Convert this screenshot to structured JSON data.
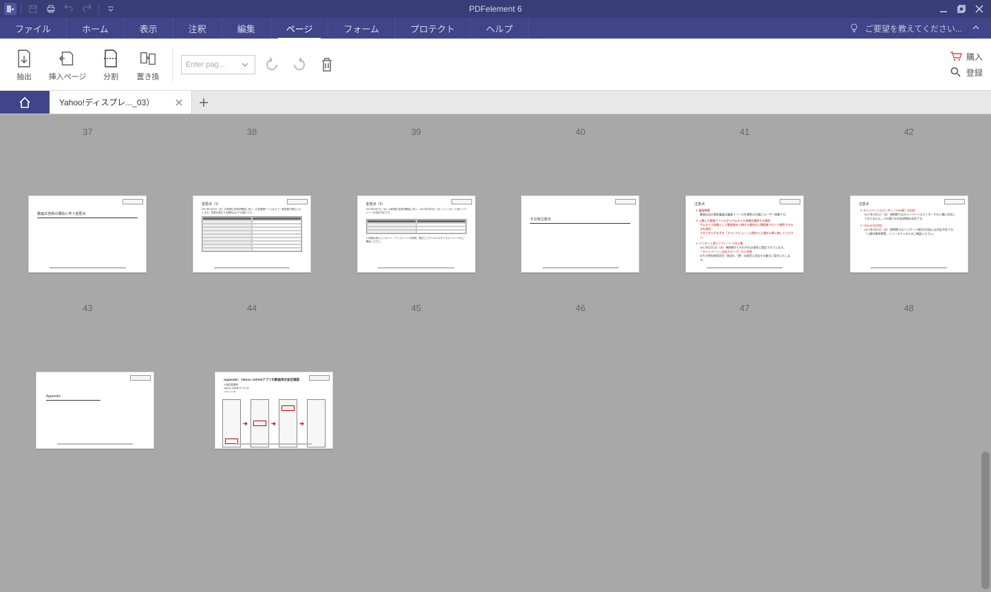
{
  "app": {
    "title": "PDFelement 6"
  },
  "menu": {
    "file": "ファイル",
    "home": "ホーム",
    "view": "表示",
    "comment": "注釈",
    "edit": "編集",
    "page": "ページ",
    "form": "フォーム",
    "protect": "プロテクト",
    "help": "ヘルプ",
    "feedback": "ご要望を教えてください..."
  },
  "ribbon": {
    "extract": "抽出",
    "insert": "挿入ページ",
    "split": "分割",
    "replace": "置き換",
    "page_input_placeholder": "Enter pag...",
    "buy": "購入",
    "register": "登録"
  },
  "tabs": {
    "doc1": "Yahoo!ディスプレ..._03）"
  },
  "pages": {
    "row1": [
      "37",
      "38",
      "39",
      "40",
      "41",
      "42"
    ],
    "row2": [
      "43",
      "44",
      "45",
      "46",
      "47",
      "48"
    ]
  },
  "thumbs": {
    "p37_title": "動画広告新の期始に伴う変更点",
    "p38_heading": "変更点（1）",
    "p38_sub": "2017年2月1日（水）の新規広告商材開始に伴い、広告管理ツールなどで一部変更が発生いたします。変更が発生する箇所は以下の通りです。",
    "p39_heading": "変更点（2）",
    "p39_sub": "2017年2月1日（水）の新規広告商材開始に伴い、2017年4月5日（水）にインポート用テンプレートを改定予定です。",
    "p40_title": "その他注意点",
    "p41_heading": "注意点",
    "p42_heading": "注意点",
    "p43_title": "Appendix",
    "p44_title": "Appendix：Yahoo! JAPANアプリの動画再生設定確認"
  }
}
